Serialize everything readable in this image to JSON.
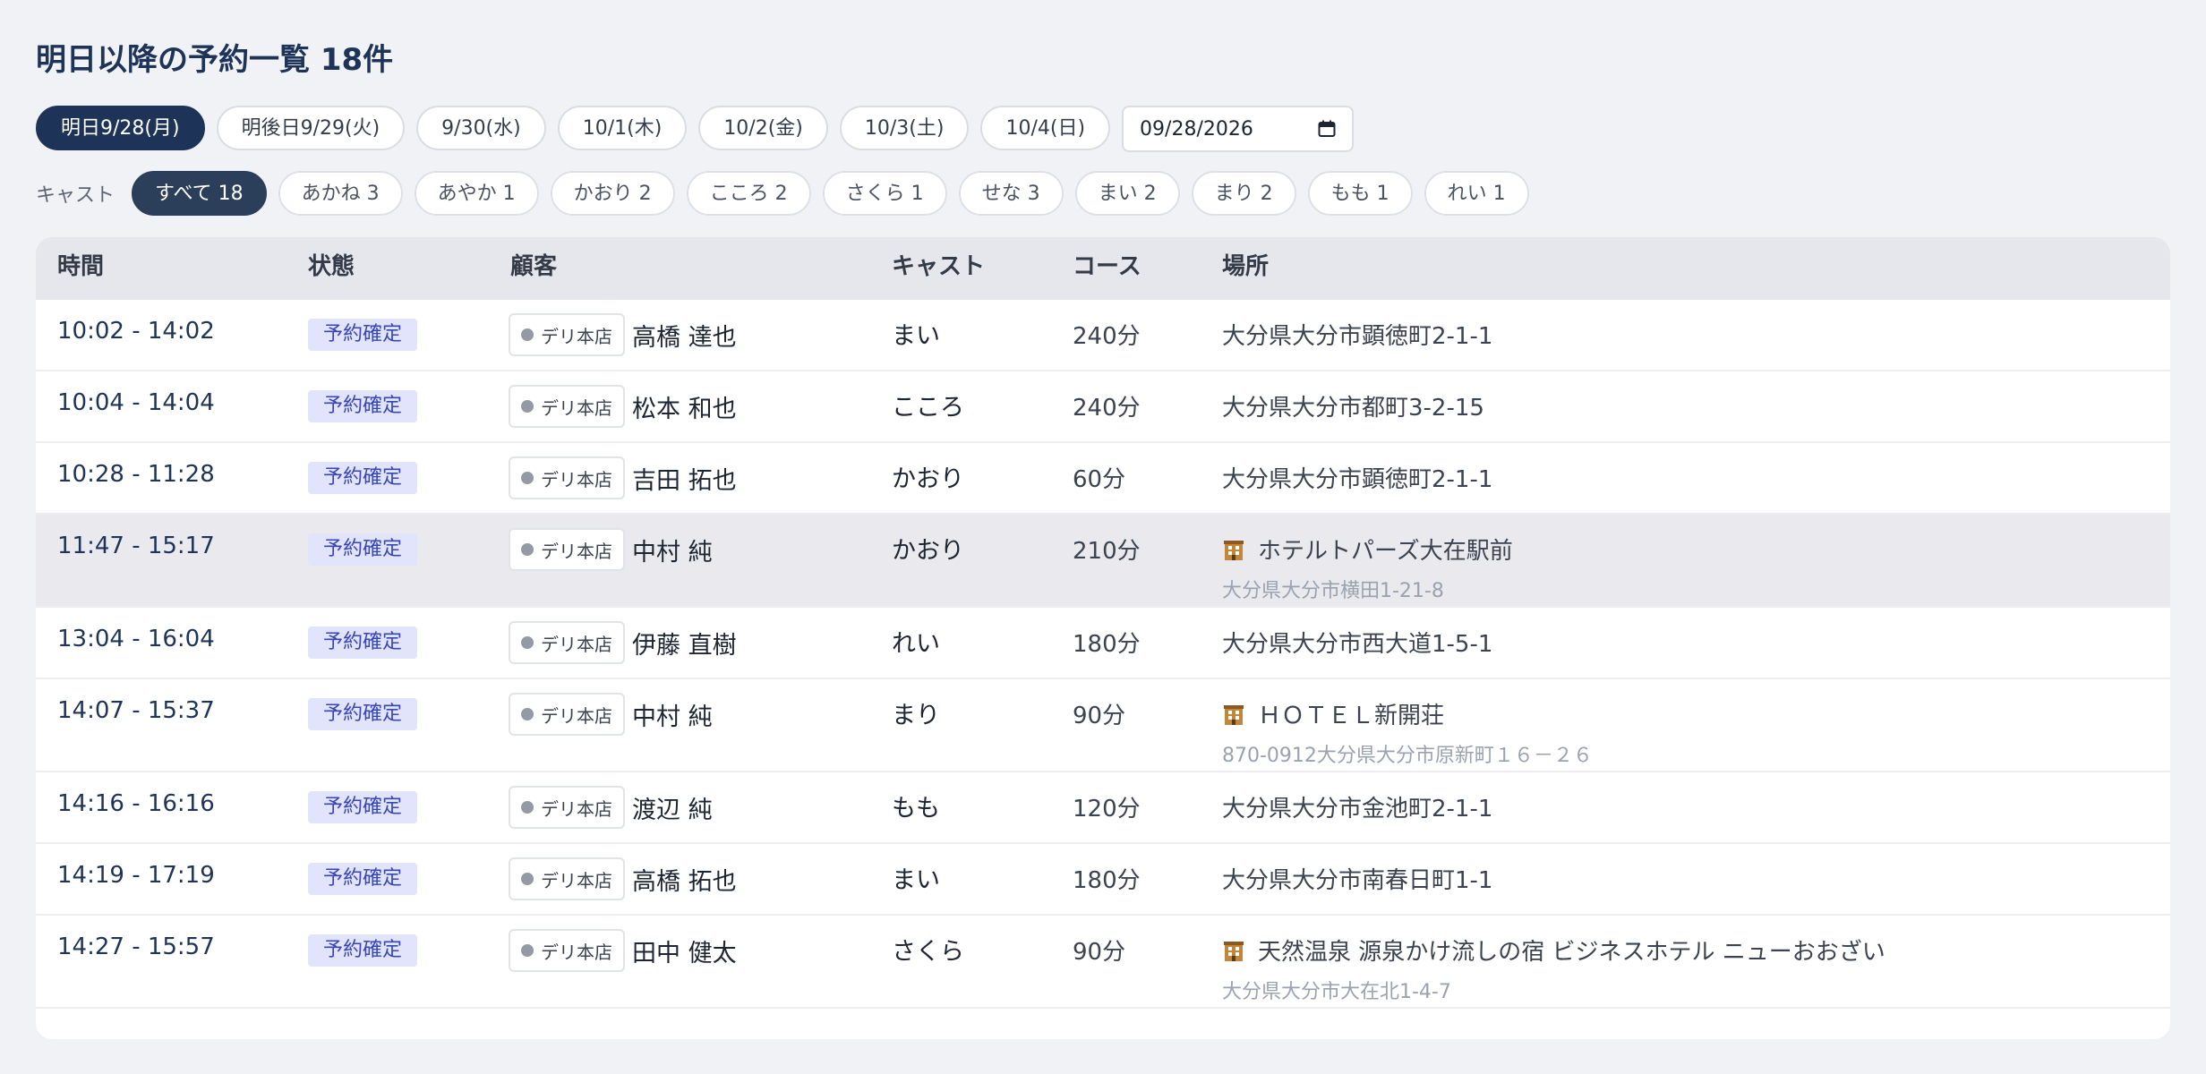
{
  "page_title": "明日以降の予約一覧 18件",
  "date_tabs": [
    {
      "label": "明日9/28(月)",
      "active": true
    },
    {
      "label": "明後日9/29(火)",
      "active": false
    },
    {
      "label": "9/30(水)",
      "active": false
    },
    {
      "label": "10/1(木)",
      "active": false
    },
    {
      "label": "10/2(金)",
      "active": false
    },
    {
      "label": "10/3(土)",
      "active": false
    },
    {
      "label": "10/4(日)",
      "active": false
    }
  ],
  "date_picker": {
    "value": "09/28/2026"
  },
  "cast_filter": {
    "label": "キャスト",
    "chips": [
      {
        "label": "すべて 18",
        "active": true
      },
      {
        "label": "あかね 3"
      },
      {
        "label": "あやか 1"
      },
      {
        "label": "かおり 2"
      },
      {
        "label": "こころ 2"
      },
      {
        "label": "さくら 1"
      },
      {
        "label": "せな 3"
      },
      {
        "label": "まい 2"
      },
      {
        "label": "まり 2"
      },
      {
        "label": "もも 1"
      },
      {
        "label": "れい 1"
      }
    ]
  },
  "table": {
    "headers": {
      "time": "時間",
      "status": "状態",
      "customer": "顧客",
      "cast": "キャスト",
      "course": "コース",
      "place": "場所"
    },
    "rows": [
      {
        "time": "10:02 - 14:02",
        "status": "予約確定",
        "store": "デリ本店",
        "customer": "高橋 達也",
        "cast": "まい",
        "course": "240分",
        "place": "大分県大分市顕徳町2-1-1",
        "place_sub": ""
      },
      {
        "time": "10:04 - 14:04",
        "status": "予約確定",
        "store": "デリ本店",
        "customer": "松本 和也",
        "cast": "こころ",
        "course": "240分",
        "place": "大分県大分市都町3-2-15",
        "place_sub": ""
      },
      {
        "time": "10:28 - 11:28",
        "status": "予約確定",
        "store": "デリ本店",
        "customer": "吉田 拓也",
        "cast": "かおり",
        "course": "60分",
        "place": "大分県大分市顕徳町2-1-1",
        "place_sub": ""
      },
      {
        "time": "11:47 - 15:17",
        "status": "予約確定",
        "store": "デリ本店",
        "customer": "中村 純",
        "cast": "かおり",
        "course": "210分",
        "place": "ホテルトパーズ大在駅前",
        "place_sub": "大分県大分市横田1-21-8",
        "hotel": true,
        "highlight": true
      },
      {
        "time": "13:04 - 16:04",
        "status": "予約確定",
        "store": "デリ本店",
        "customer": "伊藤 直樹",
        "cast": "れい",
        "course": "180分",
        "place": "大分県大分市西大道1-5-1",
        "place_sub": ""
      },
      {
        "time": "14:07 - 15:37",
        "status": "予約確定",
        "store": "デリ本店",
        "customer": "中村 純",
        "cast": "まり",
        "course": "90分",
        "place": "ＨＯＴＥＬ新開荘",
        "place_sub": "870-0912大分県大分市原新町１６－２６",
        "hotel": true
      },
      {
        "time": "14:16 - 16:16",
        "status": "予約確定",
        "store": "デリ本店",
        "customer": "渡辺 純",
        "cast": "もも",
        "course": "120分",
        "place": "大分県大分市金池町2-1-1",
        "place_sub": ""
      },
      {
        "time": "14:19 - 17:19",
        "status": "予約確定",
        "store": "デリ本店",
        "customer": "高橋 拓也",
        "cast": "まい",
        "course": "180分",
        "place": "大分県大分市南春日町1-1",
        "place_sub": ""
      },
      {
        "time": "14:27 - 15:57",
        "status": "予約確定",
        "store": "デリ本店",
        "customer": "田中 健太",
        "cast": "さくら",
        "course": "90分",
        "place": "天然温泉 源泉かけ流しの宿 ビジネスホテル ニューおおざい",
        "place_sub": "大分県大分市大在北1-4-7",
        "hotel": true
      }
    ]
  },
  "colors": {
    "accent": "#1e3358",
    "status_bg": "#e1e4fb",
    "status_text": "#3846b8",
    "background": "#f1f2f6"
  },
  "icons": {
    "hotel": "hotel-icon",
    "calendar": "calendar-icon",
    "store_dot": "store-dot-icon"
  }
}
